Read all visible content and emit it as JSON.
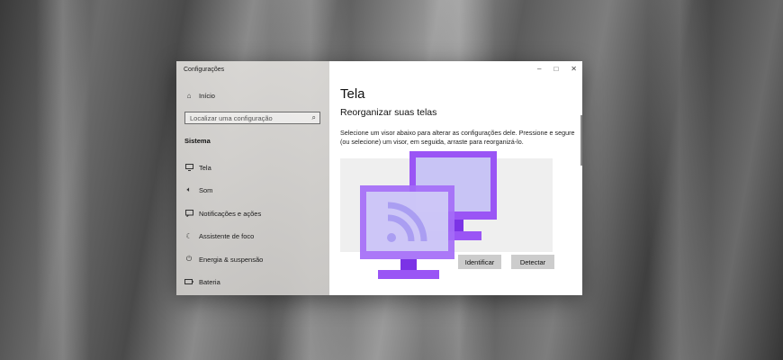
{
  "window": {
    "app_title": "Configurações",
    "controls": {
      "minimize": "–",
      "maximize": "□",
      "close": "✕"
    }
  },
  "sidebar": {
    "home": {
      "label": "Início",
      "icon": "home-icon"
    },
    "search": {
      "placeholder": "Localizar uma configuração",
      "icon": "search-icon"
    },
    "section_title": "Sistema",
    "items": [
      {
        "label": "Tela",
        "icon": "monitor-icon"
      },
      {
        "label": "Som",
        "icon": "speaker-icon"
      },
      {
        "label": "Notificações e ações",
        "icon": "notification-icon"
      },
      {
        "label": "Assistente de foco",
        "icon": "moon-icon"
      },
      {
        "label": "Energia & suspensão",
        "icon": "power-icon"
      },
      {
        "label": "Bateria",
        "icon": "battery-icon"
      }
    ]
  },
  "main": {
    "title": "Tela",
    "subtitle": "Reorganizar suas telas",
    "description": "Selecione um visor abaixo para alterar as configurações dele. Pressione e segure (ou selecione) um visor, em seguida, arraste para reorganizá-lo.",
    "buttons": {
      "identify": "Identificar",
      "detect": "Detectar"
    }
  },
  "colors": {
    "accent_purple": "#9a55f5",
    "accent_purple_dark": "#7b33e6",
    "screen_fill": "#c8c4f5"
  }
}
